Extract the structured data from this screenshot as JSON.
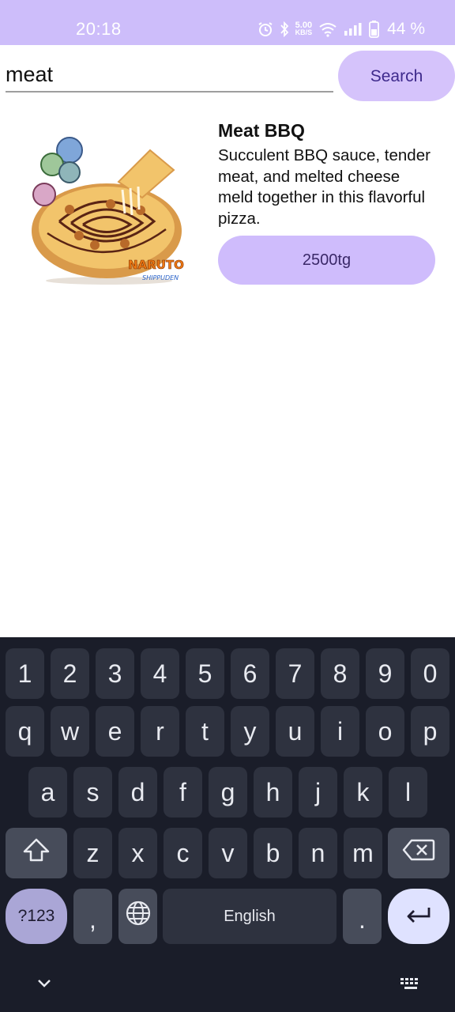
{
  "status_bar": {
    "time": "20:18",
    "net_speed_value": "5.00",
    "net_speed_unit": "KB/S",
    "battery_text": "44 %",
    "bg_color": "#cdbdfa",
    "icons": [
      "alarm-icon",
      "bluetooth-icon",
      "wifi-icon",
      "signal-icon",
      "battery-icon"
    ]
  },
  "search": {
    "query": "meat",
    "button_label": "Search"
  },
  "products": [
    {
      "title": "Meat BBQ",
      "description": "Succulent BBQ sauce, tender meat, and melted cheese meld together in this flavorful pizza.",
      "price": "2500tg",
      "image_badge": "NARUTO"
    }
  ],
  "keyboard": {
    "number_row": [
      "1",
      "2",
      "3",
      "4",
      "5",
      "6",
      "7",
      "8",
      "9",
      "0"
    ],
    "row1": [
      "q",
      "w",
      "e",
      "r",
      "t",
      "y",
      "u",
      "i",
      "o",
      "p"
    ],
    "row2": [
      "a",
      "s",
      "d",
      "f",
      "g",
      "h",
      "j",
      "k",
      "l"
    ],
    "row3": [
      "z",
      "x",
      "c",
      "v",
      "b",
      "n",
      "m"
    ],
    "mode_label": "?123",
    "comma": ",",
    "space_label": "English",
    "period": ".",
    "icons": [
      "shift-icon",
      "backspace-icon",
      "globe-icon",
      "enter-icon",
      "chevron-down-icon",
      "keyboard-icon"
    ]
  }
}
